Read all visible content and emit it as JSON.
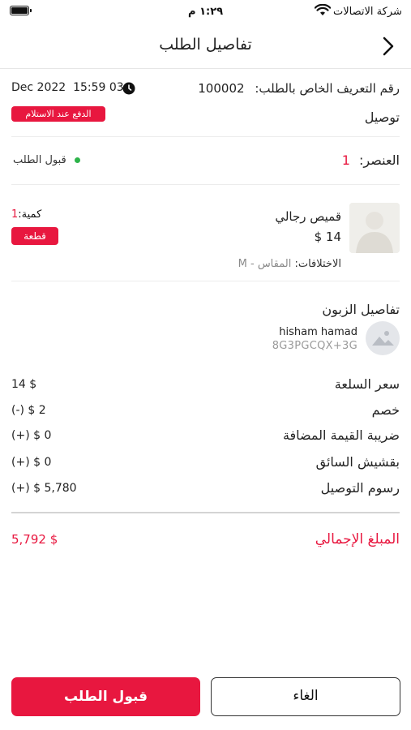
{
  "status_bar": {
    "carrier": "شركة الاتصالات",
    "time": "١:٢٩ م"
  },
  "header": {
    "title": "تفاصيل الطلب"
  },
  "order": {
    "id_label": "رقم التعريف الخاص بالطلب:",
    "id_value": "100002",
    "datetime": "Dec 2022  15:59 03",
    "delivery_type": "توصيل",
    "payment_badge": "الدفع عند الاستلام",
    "items_label": "العنصر:",
    "items_count": "1",
    "status_text": "قبول الطلب",
    "status_dot_color": "#2db34a"
  },
  "product": {
    "name": "قميص رجالي",
    "price": "$ 14",
    "variations_label": "الاختلافات:",
    "variations_value": "المقاس - M",
    "qty_label": "كمية:",
    "qty_value": "1",
    "unit_badge": "قطعة"
  },
  "customer": {
    "section_title": "تفاصيل الزبون",
    "name": "hisham hamad",
    "address": "8G3PGCQX+3G"
  },
  "summary": {
    "item_price_label": "سعر السلعة",
    "item_price_value": "14 $",
    "discount_label": "خصم",
    "discount_value": "(-) $ 2",
    "vat_label": "ضريبة القيمة المضافة",
    "vat_value": "(+) $ 0",
    "tip_label": "بقشيش السائق",
    "tip_value": "(+) $ 0",
    "delivery_fee_label": "رسوم التوصيل",
    "delivery_fee_value": "(+) $ 5,780",
    "total_label": "المبلغ الإجمالي",
    "total_value": "5,792 $"
  },
  "actions": {
    "accept_label": "قبول الطلب",
    "cancel_label": "الغاء"
  },
  "colors": {
    "accent": "#e8173f"
  }
}
